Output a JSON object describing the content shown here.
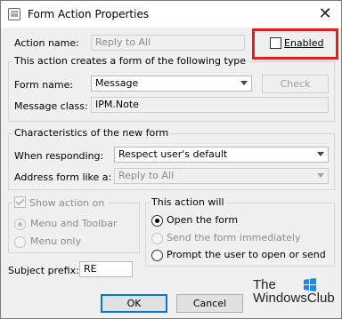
{
  "window": {
    "title": "Form Action Properties",
    "close_glyph": "✕"
  },
  "action_name": {
    "label": "Action name:",
    "value": "Reply to All",
    "enabled_label": "Enabled"
  },
  "form_type_group": {
    "title": "This action creates a form of the following type",
    "form_name_label": "Form name:",
    "form_name_value": "Message",
    "check_button": "Check",
    "message_class_label": "Message class:",
    "message_class_value": "IPM.Note"
  },
  "characteristics_group": {
    "title": "Characteristics of the new form",
    "when_responding_label": "When responding:",
    "when_responding_value": "Respect user's default",
    "address_form_label": "Address form like a:",
    "address_form_value": "Reply to All"
  },
  "show_action": {
    "label": "Show action on",
    "option_menu_toolbar": "Menu and Toolbar",
    "option_menu_only": "Menu only"
  },
  "this_action_will": {
    "title": "This action will",
    "option_open": "Open the form",
    "option_send": "Send the form immediately",
    "option_prompt": "Prompt the user to open or send"
  },
  "subject_prefix": {
    "label": "Subject prefix:",
    "value": "RE"
  },
  "buttons": {
    "ok": "OK",
    "cancel": "Cancel"
  },
  "watermark": {
    "line1": "The",
    "line2": "WindowsClub"
  },
  "colors": {
    "highlight": "#e02020",
    "default_button_border": "#0078d7",
    "watermark_logo": "#1e88e5"
  }
}
